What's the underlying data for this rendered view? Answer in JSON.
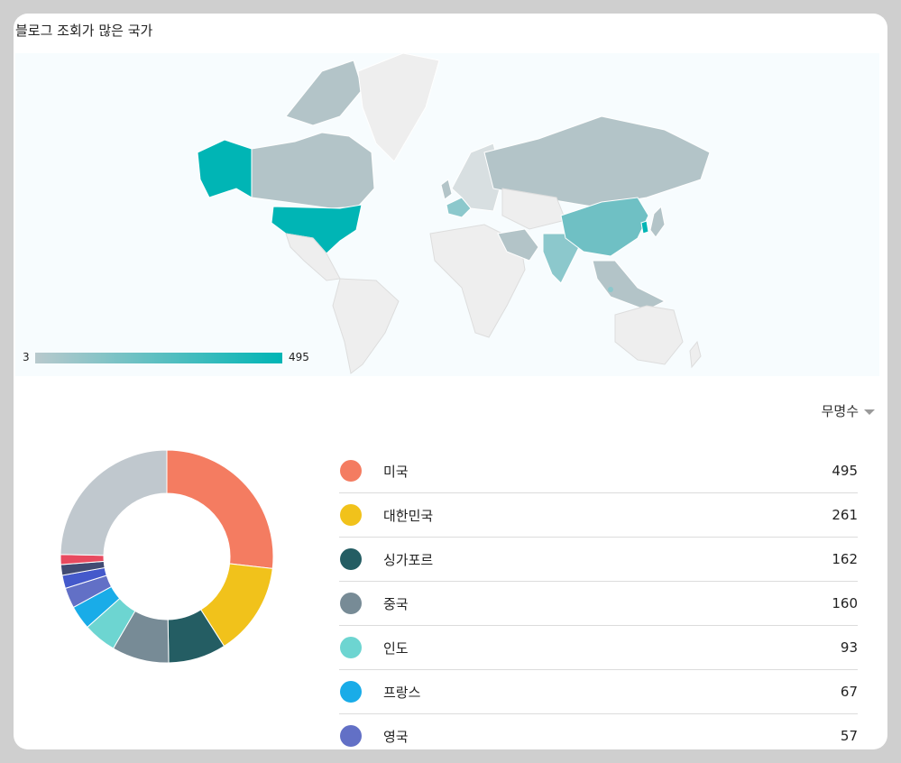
{
  "card": {
    "title": "블로그 조회가 많은 국가"
  },
  "map": {
    "legend_min": "3",
    "legend_max": "495",
    "color_low": "#b8c9cd",
    "color_high": "#00b5b5",
    "no_data_color": "#eeeeee",
    "ocean_color": "#f7fcfe"
  },
  "metric_selector": {
    "label": "무명수"
  },
  "chart_data": {
    "type": "pie",
    "subtype": "donut",
    "categories": [
      "미국",
      "대한민국",
      "싱가포르",
      "중국",
      "인도",
      "프랑스",
      "영국",
      "",
      "",
      "",
      ""
    ],
    "values": [
      495,
      261,
      162,
      160,
      93,
      67,
      57,
      37,
      30,
      28,
      456
    ],
    "colors": [
      "#f47c61",
      "#f1c21b",
      "#245d63",
      "#778b96",
      "#6dd5d1",
      "#19ace8",
      "#6270c6",
      "#4459cb",
      "#414b73",
      "#e84a5f",
      "#c0c8ce"
    ]
  },
  "list": [
    {
      "name": "미국",
      "value": "495",
      "color": "#f47c61"
    },
    {
      "name": "대한민국",
      "value": "261",
      "color": "#f1c21b"
    },
    {
      "name": "싱가포르",
      "value": "162",
      "color": "#245d63"
    },
    {
      "name": "중국",
      "value": "160",
      "color": "#778b96"
    },
    {
      "name": "인도",
      "value": "93",
      "color": "#6dd5d1"
    },
    {
      "name": "프랑스",
      "value": "67",
      "color": "#19ace8"
    },
    {
      "name": "영국",
      "value": "57",
      "color": "#6270c6"
    }
  ]
}
